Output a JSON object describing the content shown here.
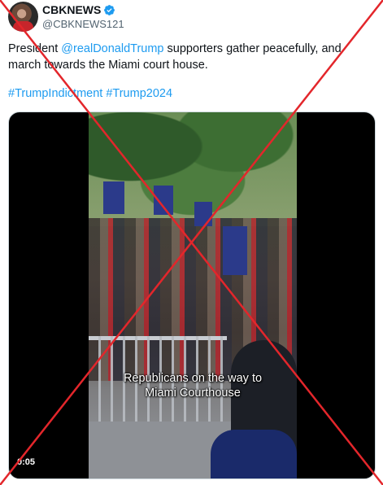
{
  "author": {
    "display_name": "CBKNEWS",
    "handle": "@CBKNEWS121",
    "verified": true,
    "verified_color": "#1d9bf0"
  },
  "tweet": {
    "text_before": "President ",
    "mention": "@realDonaldTrump",
    "text_after": " supporters gather peacefully, and march towards the Miami court house.",
    "hashtag_1": "#TrumpIndictment",
    "hashtag_2": "#Trump2024"
  },
  "video": {
    "caption_line_1": "Republicans on the way to",
    "caption_line_2": "Miami Courthouse",
    "timestamp": "0:05"
  },
  "overlay": {
    "cross_color": "#e3262b"
  },
  "colors": {
    "link": "#1d9bf0",
    "text": "#0f1419",
    "secondary": "#536471"
  },
  "icons": [
    "verified-badge-icon"
  ]
}
